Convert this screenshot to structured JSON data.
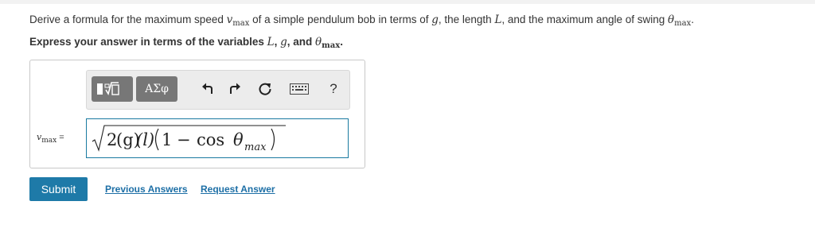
{
  "question": {
    "prefix": "Derive a formula for the maximum speed ",
    "v": "v",
    "max": "max",
    "mid": " of a simple pendulum bob in terms of ",
    "g": "g",
    "mid2": ", the length ",
    "L": "L",
    "mid3": ", and the maximum angle of swing ",
    "theta": "θ",
    "end": "."
  },
  "instruction": {
    "prefix": "Express your answer in terms of the variables ",
    "L": "L",
    "sep1": ", ",
    "g": "g",
    "sep2": ", and ",
    "theta": "θ",
    "max": "max",
    "end": "."
  },
  "toolbar": {
    "templates_icon": "templates-icon",
    "greek_label": "ΑΣφ",
    "undo_icon": "undo-icon",
    "redo_icon": "redo-icon",
    "reset_icon": "reset-icon",
    "keyboard_icon": "keyboard-icon",
    "help_label": "?"
  },
  "answer": {
    "var": "v",
    "sub": "max",
    "eq": " =",
    "expr_two": "2",
    "expr_g": "(g)",
    "expr_l": "(l)",
    "expr_one": "1",
    "expr_minus": "−",
    "expr_cos": "cos",
    "expr_theta": "θ",
    "expr_sub": "max"
  },
  "actions": {
    "submit": "Submit",
    "previous_answers": "Previous Answers",
    "request_answer": "Request Answer"
  },
  "colors": {
    "accent": "#1e7aa8",
    "link": "#1d6fa6",
    "toolbar_button": "#777777"
  }
}
